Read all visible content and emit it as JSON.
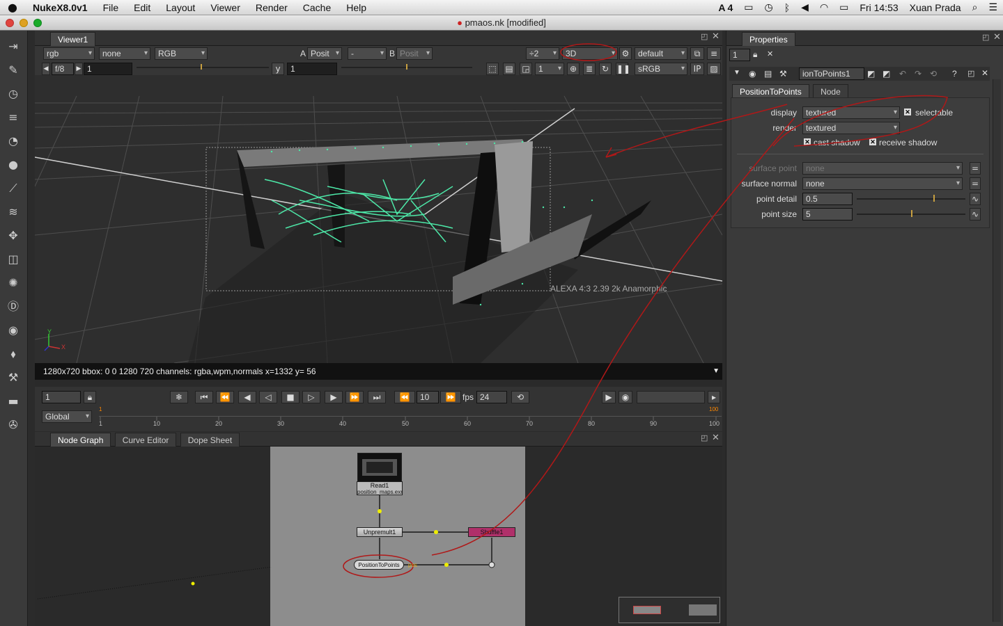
{
  "menubar": {
    "app": "NukeX8.0v1",
    "items": [
      "File",
      "Edit",
      "Layout",
      "Viewer",
      "Render",
      "Cache",
      "Help"
    ],
    "status_adobe": "4",
    "clock": "Fri 14:53",
    "user": "Xuan Prada"
  },
  "window": {
    "title": "pmaos.nk [modified]"
  },
  "viewer": {
    "tab": "Viewer1",
    "channels": "rgb",
    "alpha": "none",
    "display_channels": "RGB",
    "a_label": "A",
    "a_input": "Posit",
    "blend": "-",
    "b_label": "B",
    "b_input": "Posit",
    "downscale": "÷2",
    "view_mode": "3D",
    "lut_default": "default",
    "fstop": "f/8",
    "gain": "1",
    "gamma_label": "y",
    "gamma": "1",
    "proxy": "1",
    "colorspace": "sRGB",
    "ip": "IP",
    "format_label": "ALEXA 4:3 2.39 2k Anamorphic",
    "axis_y": "Y",
    "axis_x": "X",
    "info": "1280x720 bbox: 0 0 1280 720 channels: rgba,wpm,normals   x=1332 y=  56"
  },
  "timeline": {
    "frame": "1",
    "step": "10",
    "fps_label": "fps",
    "fps": "24",
    "range_mode": "Global",
    "ticks": [
      "1",
      "10",
      "20",
      "30",
      "40",
      "50",
      "60",
      "70",
      "80",
      "90",
      "100"
    ],
    "start_marker": "1",
    "end_marker": "100"
  },
  "node_graph": {
    "tabs": [
      "Node Graph",
      "Curve Editor",
      "Dope Sheet"
    ],
    "nodes": {
      "read": "Read1",
      "read_file": "position_maps.exr",
      "unpremult": "Unpremult1",
      "shuffle": "Shuffle1",
      "p2p": "PositionToPoints",
      "pos_label": "pos"
    }
  },
  "properties": {
    "title": "Properties",
    "max_panels": "1",
    "node_name": "ionToPoints1",
    "tabs": [
      "PositionToPoints",
      "Node"
    ],
    "display_label": "display",
    "display_value": "textured",
    "selectable_label": "selectable",
    "render_label": "render",
    "render_value": "textured",
    "cast_shadow_label": "cast shadow",
    "receive_shadow_label": "receive shadow",
    "surface_point_label": "surface point",
    "surface_point_value": "none",
    "surface_normal_label": "surface normal",
    "surface_normal_value": "none",
    "point_detail_label": "point detail",
    "point_detail_value": "0.5",
    "point_size_label": "point size",
    "point_size_value": "5"
  },
  "colors": {
    "annotation": "#b01818",
    "points": "#4de8a8",
    "shuffle": "#b0306a"
  }
}
